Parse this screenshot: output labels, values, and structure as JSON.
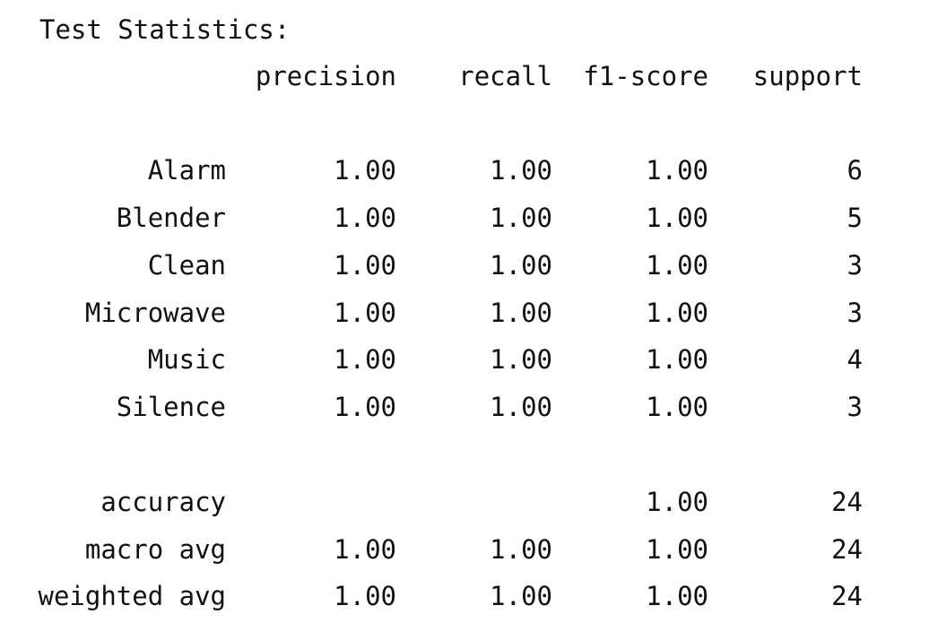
{
  "report": {
    "title": "Test Statistics:",
    "headers": [
      "precision",
      "recall",
      "f1-score",
      "support"
    ],
    "rows": [
      {
        "label": "Alarm",
        "precision": "1.00",
        "recall": "1.00",
        "f1": "1.00",
        "support": "6"
      },
      {
        "label": "Blender",
        "precision": "1.00",
        "recall": "1.00",
        "f1": "1.00",
        "support": "5"
      },
      {
        "label": "Clean",
        "precision": "1.00",
        "recall": "1.00",
        "f1": "1.00",
        "support": "3"
      },
      {
        "label": "Microwave",
        "precision": "1.00",
        "recall": "1.00",
        "f1": "1.00",
        "support": "3"
      },
      {
        "label": "Music",
        "precision": "1.00",
        "recall": "1.00",
        "f1": "1.00",
        "support": "4"
      },
      {
        "label": "Silence",
        "precision": "1.00",
        "recall": "1.00",
        "f1": "1.00",
        "support": "3"
      }
    ],
    "summary": [
      {
        "label": "accuracy",
        "precision": "",
        "recall": "",
        "f1": "1.00",
        "support": "24"
      },
      {
        "label": "macro avg",
        "precision": "1.00",
        "recall": "1.00",
        "f1": "1.00",
        "support": "24"
      },
      {
        "label": "weighted avg",
        "precision": "1.00",
        "recall": "1.00",
        "f1": "1.00",
        "support": "24"
      }
    ]
  }
}
